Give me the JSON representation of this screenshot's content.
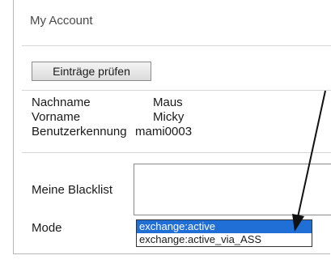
{
  "panel": {
    "title": "My Account",
    "check_button_label": "Einträge prüfen"
  },
  "user_info": [
    {
      "label": "Nachname",
      "value": "Maus"
    },
    {
      "label": "Vorname",
      "value": "Micky"
    },
    {
      "label": "Benutzerkennung",
      "value": "mami0003"
    }
  ],
  "blacklist": {
    "label": "Meine Blacklist",
    "value": ""
  },
  "mode": {
    "label": "Mode",
    "options": [
      "exchange:active",
      "exchange:active_via_ASS"
    ],
    "selected": "exchange:active"
  },
  "colors": {
    "selected_option": "#1f6fd6",
    "annotation_arrow": "#111111"
  },
  "annotation": {
    "icon": "pointer-arrow-icon"
  }
}
